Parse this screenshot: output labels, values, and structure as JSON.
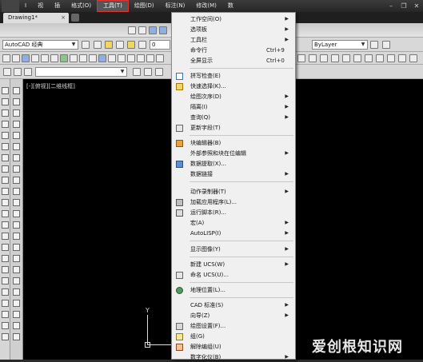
{
  "menubar": {
    "items": [
      "I",
      "视",
      "插",
      "格式(O)",
      "工具(T)",
      "绘图(D)",
      "标注(N)",
      "修改(M)",
      "数"
    ],
    "active_index": 4
  },
  "tabs": {
    "document": "Drawing1*"
  },
  "toolbar": {
    "workspace": "AutoCAD 经典",
    "layer_value": "0",
    "linetype_value": "ByLayer"
  },
  "viewport": {
    "label": "[-][俯视][二维线框]",
    "ucs_y": "Y"
  },
  "menu": {
    "items": [
      {
        "label": "工作空间(O)",
        "submenu": true
      },
      {
        "label": "选项板",
        "submenu": true
      },
      {
        "label": "工具栏",
        "submenu": true
      },
      {
        "label": "命令行",
        "shortcut": "Ctrl+9"
      },
      {
        "label": "全屏显示",
        "shortcut": "Ctrl+0"
      },
      {
        "label": "拼写检查(E)",
        "icon": "spell-check-icon"
      },
      {
        "label": "快速选择(K)...",
        "icon": "quick-select-icon"
      },
      {
        "label": "绘图次序(D)",
        "submenu": true
      },
      {
        "label": "隔离(I)",
        "submenu": true
      },
      {
        "label": "查询(Q)",
        "submenu": true
      },
      {
        "label": "更新字段(T)",
        "icon": "update-field-icon"
      },
      {
        "label": "块编辑器(B)",
        "icon": "block-editor-icon"
      },
      {
        "label": "外部参照和块在位编辑",
        "submenu": true
      },
      {
        "label": "数据提取(X)...",
        "icon": "data-extraction-icon"
      },
      {
        "label": "数据链接",
        "submenu": true
      },
      {
        "label": "动作录制器(T)",
        "submenu": true
      },
      {
        "label": "加载应用程序(L)...",
        "icon": "load-application-icon"
      },
      {
        "label": "运行脚本(R)...",
        "icon": "run-script-icon"
      },
      {
        "label": "宏(A)",
        "submenu": true
      },
      {
        "label": "AutoLISP(I)",
        "submenu": true
      },
      {
        "label": "显示图像(Y)",
        "submenu": true
      },
      {
        "label": "新建 UCS(W)",
        "submenu": true
      },
      {
        "label": "命名 UCS(U)...",
        "icon": "named-ucs-icon"
      },
      {
        "label": "地理位置(L)...",
        "icon": "geolocation-icon"
      },
      {
        "label": "CAD 标准(S)",
        "submenu": true
      },
      {
        "label": "向导(Z)",
        "submenu": true
      },
      {
        "label": "绘图设置(F)...",
        "icon": "drafting-settings-icon"
      },
      {
        "label": "组(G)",
        "icon": "group-icon"
      },
      {
        "label": "解除编组(U)",
        "icon": "ungroup-icon"
      },
      {
        "label": "数字化仪(B)",
        "submenu": true
      }
    ]
  },
  "watermark": "爱创根知识网"
}
